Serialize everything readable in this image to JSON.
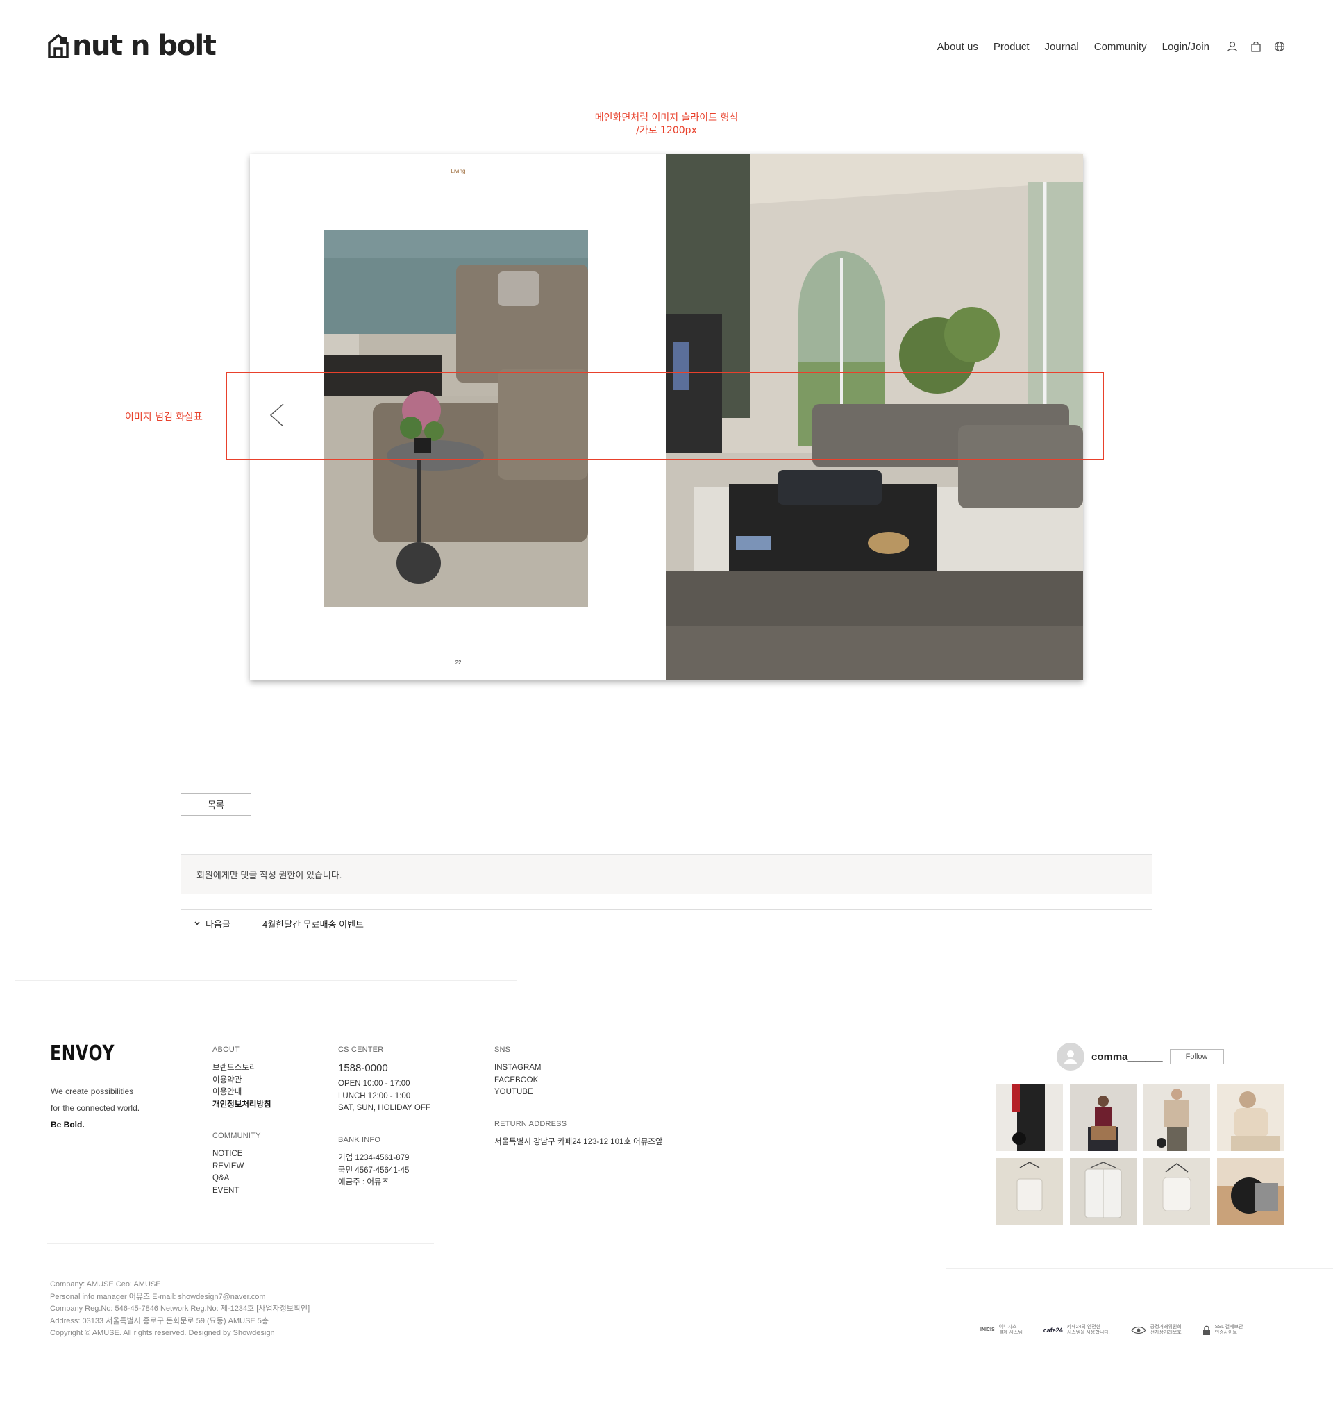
{
  "header": {
    "logo": "nut n bolt",
    "nav": [
      "About us",
      "Product",
      "Journal",
      "Community",
      "Login/Join"
    ],
    "icons": [
      "user-icon",
      "bag-icon",
      "globe-icon"
    ]
  },
  "annotations": {
    "slide_note_line1": "메인화면처럼 이미지 슬라이드 형식",
    "slide_note_line2": "/가로 1200px",
    "arrow_note": "이미지 넘김 화살표",
    "color": "#e8412c"
  },
  "slide": {
    "page_label": "Living",
    "page_number": "22"
  },
  "board": {
    "list_button": "목록",
    "comment_notice": "회원에게만 댓글 작성 권한이 있습니다.",
    "next_label": "다음글",
    "next_title": "4월한달간 무료배송 이벤트"
  },
  "footer": {
    "brand": "ENVOY",
    "tagline1": "We create possibilities",
    "tagline2": "for the connected world.",
    "tagline3": "Be Bold.",
    "about": {
      "heading": "ABOUT",
      "items": [
        "브랜드스토리",
        "이용약관",
        "이용안내",
        "개인정보처리방침"
      ]
    },
    "community": {
      "heading": "COMMUNITY",
      "items": [
        "NOTICE",
        "REVIEW",
        "Q&A",
        "EVENT"
      ]
    },
    "cs": {
      "heading": "CS CENTER",
      "phone": "1588-0000",
      "hours": [
        "OPEN 10:00 - 17:00",
        "LUNCH 12:00 - 1:00",
        "SAT, SUN, HOLIDAY OFF"
      ]
    },
    "bank": {
      "heading": "BANK INFO",
      "items": [
        "기업 1234-4561-879",
        "국민 4567-45641-45",
        "예금주 : 어뮤즈"
      ]
    },
    "sns": {
      "heading": "SNS",
      "items": [
        "INSTAGRAM",
        "FACEBOOK",
        "YOUTUBE"
      ]
    },
    "return": {
      "heading": "RETURN ADDRESS",
      "address": "서울특별시 강남구 카페24 123-12 101호 어뮤즈앞"
    },
    "company_lines": [
      "Company: AMUSE   Ceo: AMUSE",
      "Personal info manager 어뮤즈   E-mail: showdesign7@naver.com",
      "Company Reg.No: 546-45-7846   Network Reg.No: 제-1234호 [사업자정보확인]",
      "Address: 03133 서울특별시 종로구 돈화문로 59 (묘동) AMUSE 5층",
      "Copyright © AMUSE. All rights reserved. Designed by Showdesign"
    ],
    "instagram": {
      "username": "comma______",
      "follow": "Follow"
    },
    "badges": [
      {
        "logo": "INICIS",
        "text1": "이니시스",
        "text2": "결제 시스템"
      },
      {
        "logo": "cafe24",
        "text1": "카페24의 안전한",
        "text2": "시스템을 사용합니다."
      },
      {
        "logo": "eye",
        "text1": "공정거래위원회",
        "text2": "전자상거래보호"
      },
      {
        "logo": "lock",
        "text1": "SSL 결제보안",
        "text2": "인증사이트"
      }
    ]
  }
}
